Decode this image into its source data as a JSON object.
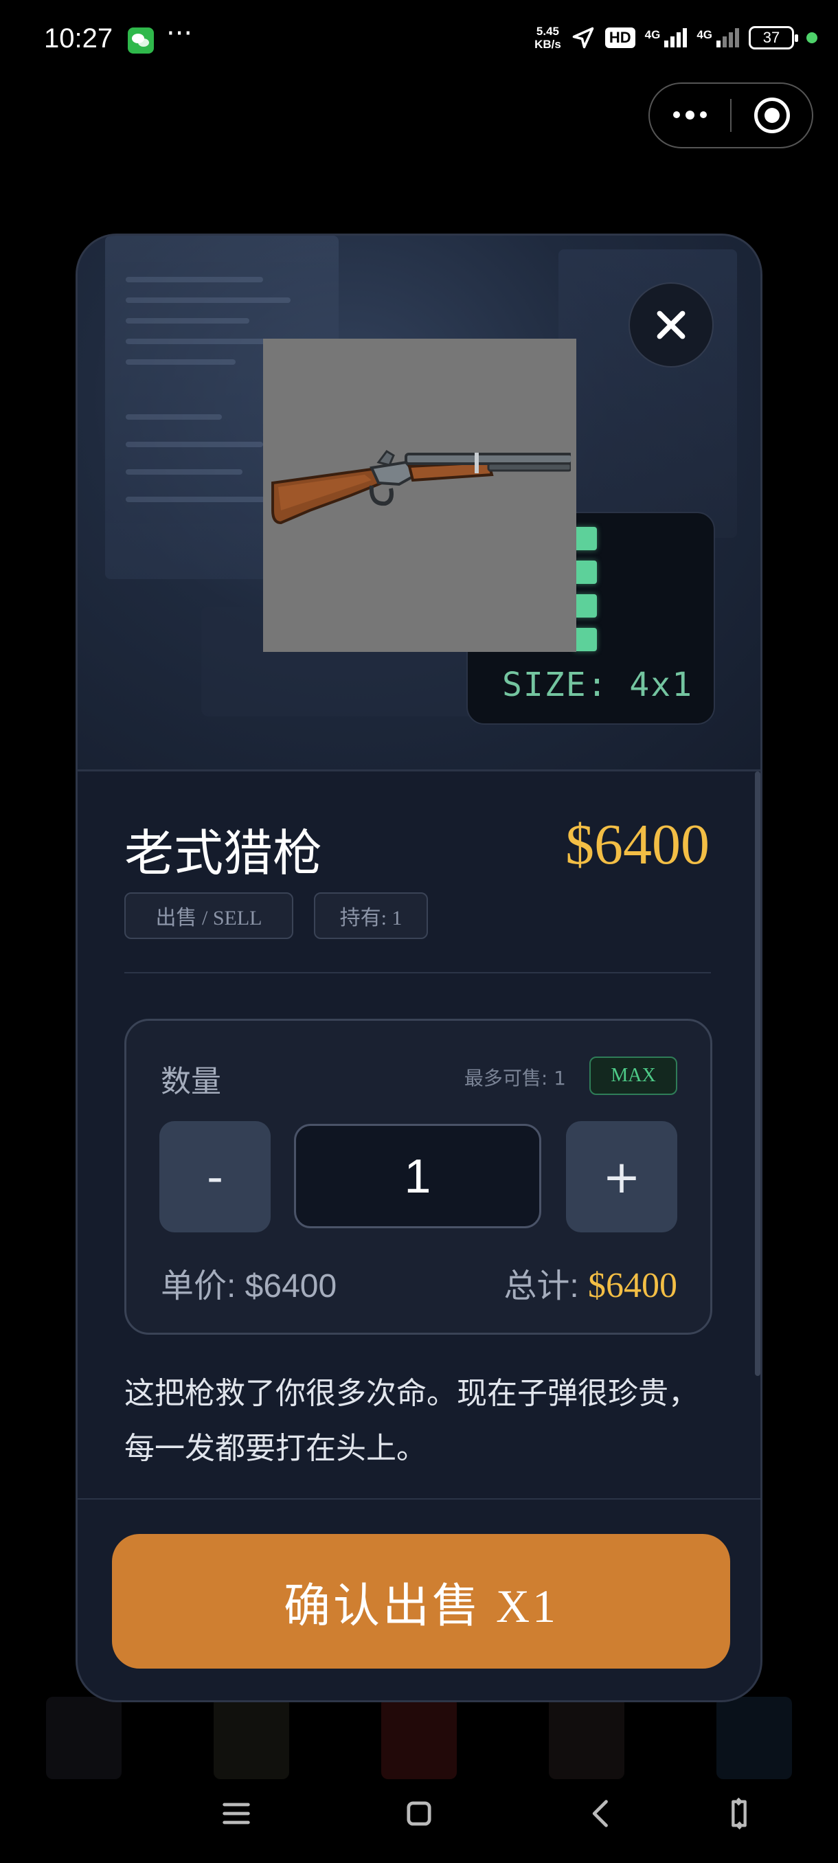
{
  "status_bar": {
    "time": "10:27",
    "speed_value": "5.45",
    "speed_unit": "KB/s",
    "hd": "HD",
    "net1": "4G",
    "net2": "4G",
    "battery": "37"
  },
  "item": {
    "name": "老式猎枪",
    "price": "$6400",
    "tag_sell": "出售 / SELL",
    "tag_hold": "持有: 1",
    "size": "SIZE: 4x1",
    "size_cells": 4,
    "description": "这把枪救了你很多次命。现在子弹很珍贵，每一发都要打在头上。"
  },
  "quantity": {
    "label": "数量",
    "max_info": "最多可售: 1",
    "max_button": "MAX",
    "minus": "-",
    "plus": "+",
    "value": "1",
    "unit_price": "单价: $6400",
    "total_label": "总计: ",
    "total_value": "$6400"
  },
  "confirm_button": "确认出售 X1",
  "colors": {
    "accent_gold": "#f3be45",
    "confirm_orange": "#cf7f31",
    "size_green": "#5dd19a",
    "modal_bg": "#151c2c"
  }
}
